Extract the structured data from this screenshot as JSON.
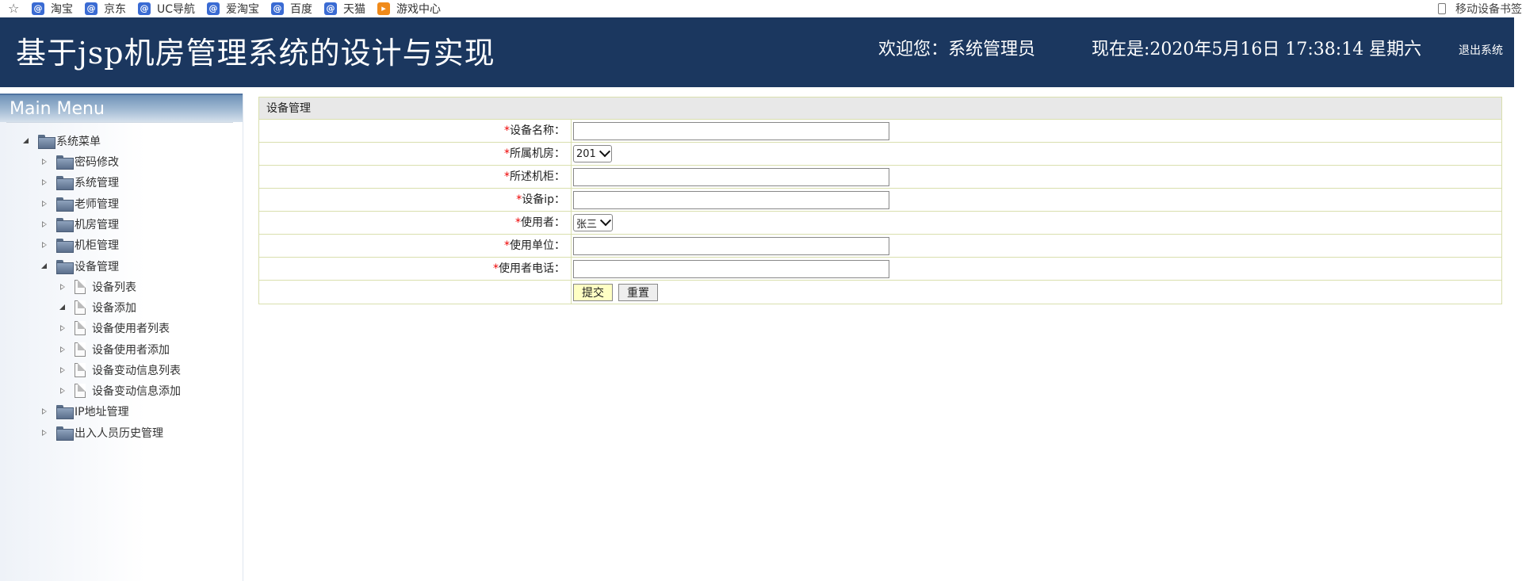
{
  "bookmarks": {
    "items": [
      {
        "label": "淘宝",
        "icon": "taobao-icon"
      },
      {
        "label": "京东",
        "icon": "jd-icon"
      },
      {
        "label": "UC导航",
        "icon": "uc-icon"
      },
      {
        "label": "爱淘宝",
        "icon": "aitaobao-icon"
      },
      {
        "label": "百度",
        "icon": "baidu-icon"
      },
      {
        "label": "天猫",
        "icon": "tmall-icon"
      },
      {
        "label": "游戏中心",
        "icon": "game-icon"
      }
    ],
    "right_label": "移动设备书签"
  },
  "header": {
    "title": "基于jsp机房管理系统的设计与实现",
    "welcome": "欢迎您：系统管理员",
    "datetime": "现在是:2020年5月16日 17:38:14 星期六",
    "logout": "退出系统"
  },
  "sidebar": {
    "heading": "Main Menu",
    "root": "系统菜单",
    "items": [
      "密码修改",
      "系统管理",
      "老师管理",
      "机房管理",
      "机柜管理",
      "设备管理",
      "IP地址管理",
      "出入人员历史管理"
    ],
    "sub_items": [
      "设备列表",
      "设备添加",
      "设备使用者列表",
      "设备使用者添加",
      "设备变动信息列表",
      "设备变动信息添加"
    ]
  },
  "form": {
    "title": "设备管理",
    "required_mark": "*",
    "fields": {
      "name_label": "设备名称：",
      "room_label": "所属机房：",
      "room_value": "201",
      "cabinet_label": "所述机柜：",
      "ip_label": "设备ip：",
      "user_label": "使用者：",
      "user_value": "张三",
      "unit_label": "使用单位：",
      "phone_label": "使用者电话："
    },
    "submit": "提交",
    "reset": "重置"
  }
}
